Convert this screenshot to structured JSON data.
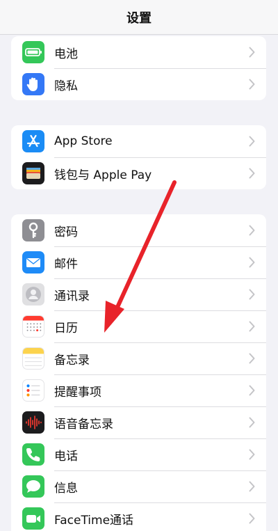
{
  "navbar": {
    "title": "设置"
  },
  "group1": [
    {
      "label": "电池",
      "icon": "battery-icon",
      "color": "#34c759"
    },
    {
      "label": "隐私",
      "icon": "hand-icon",
      "color": "#3478f6"
    }
  ],
  "group2": [
    {
      "label": "App Store",
      "icon": "app-store-icon",
      "color": "#1b8cf5"
    },
    {
      "label": "钱包与 Apple Pay",
      "icon": "wallet-icon",
      "color": "#1c1c1e"
    }
  ],
  "group3": [
    {
      "label": "密码",
      "icon": "key-icon",
      "color": "#8e8e93"
    },
    {
      "label": "邮件",
      "icon": "mail-icon",
      "color": "#1e8bf7"
    },
    {
      "label": "通讯录",
      "icon": "contacts-icon",
      "color": "#c7c7cc"
    },
    {
      "label": "日历",
      "icon": "calendar-icon",
      "color": "#ffffff"
    },
    {
      "label": "备忘录",
      "icon": "notes-icon",
      "color": "#ffffff"
    },
    {
      "label": "提醒事项",
      "icon": "reminders-icon",
      "color": "#ffffff"
    },
    {
      "label": "语音备忘录",
      "icon": "voice-memos-icon",
      "color": "#1c1c1e"
    },
    {
      "label": "电话",
      "icon": "phone-icon",
      "color": "#34c759"
    },
    {
      "label": "信息",
      "icon": "messages-icon",
      "color": "#34c759"
    },
    {
      "label": "FaceTime通话",
      "icon": "facetime-icon",
      "color": "#34c759"
    }
  ],
  "overlay": {
    "arrow_color": "#e8232a",
    "icon": "red-arrow-annotation-icon"
  }
}
